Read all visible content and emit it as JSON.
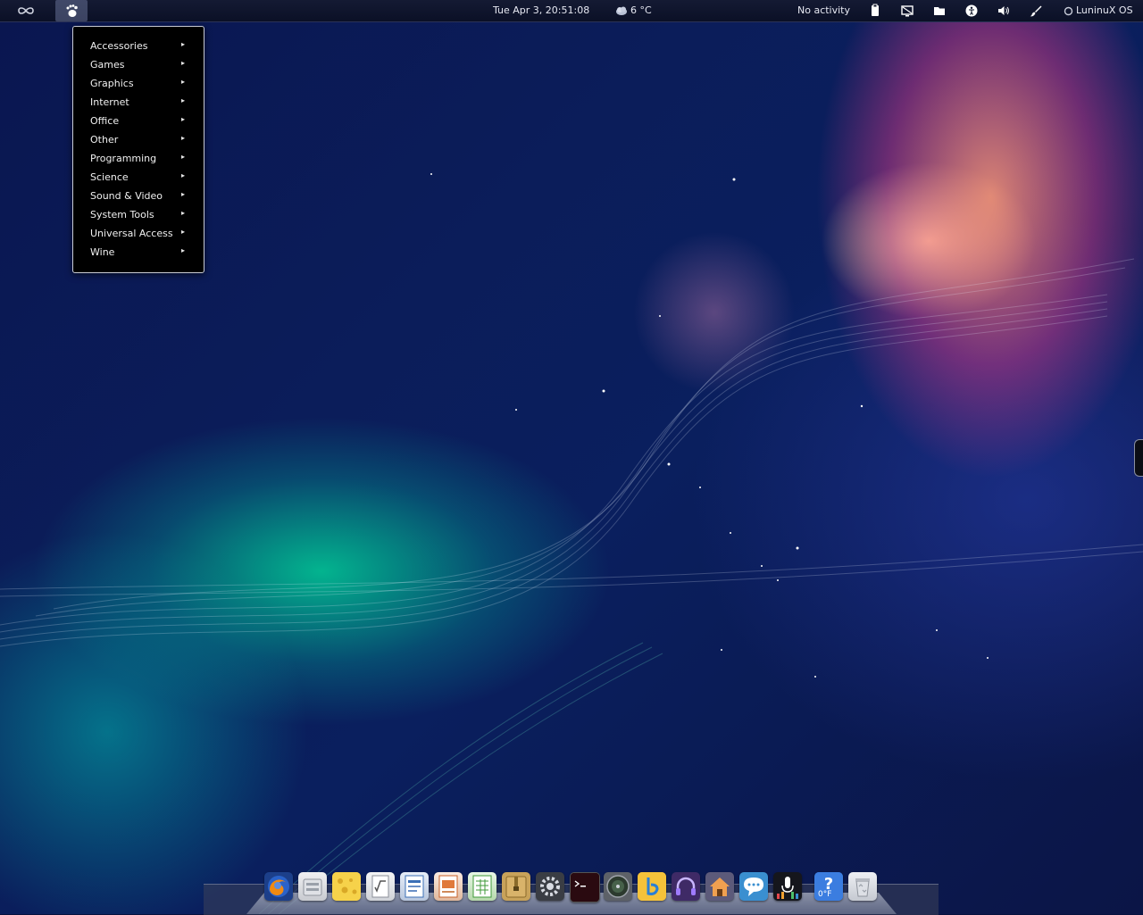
{
  "top_panel": {
    "activities_icon": "infinity-icon",
    "menu_icon": "gnome-foot-icon",
    "clock": "Tue Apr  3, 20:51:08",
    "weather": {
      "icon": "cloud-weather-icon",
      "temperature": "6 °C"
    },
    "activity_status": "No activity",
    "tray_icons": [
      "clipboard-icon",
      "display-icon",
      "folder-icon",
      "accessibility-icon",
      "volume-icon",
      "brush-icon"
    ],
    "user": {
      "icon": "user-status-icon",
      "name": "LuninuX OS"
    }
  },
  "app_menu": {
    "items": [
      {
        "label": "Accessories"
      },
      {
        "label": "Games"
      },
      {
        "label": "Graphics"
      },
      {
        "label": "Internet"
      },
      {
        "label": "Office"
      },
      {
        "label": "Other"
      },
      {
        "label": "Programming"
      },
      {
        "label": "Science"
      },
      {
        "label": "Sound & Video"
      },
      {
        "label": "System Tools"
      },
      {
        "label": "Universal Access"
      },
      {
        "label": "Wine"
      }
    ],
    "submenu_arrow": "▸"
  },
  "dock": {
    "items": [
      {
        "icon": "firefox-icon"
      },
      {
        "icon": "file-manager-icon"
      },
      {
        "icon": "cheese-icon"
      },
      {
        "icon": "libreoffice-math-icon"
      },
      {
        "icon": "libreoffice-writer-icon"
      },
      {
        "icon": "libreoffice-impress-icon"
      },
      {
        "icon": "libreoffice-calc-icon"
      },
      {
        "icon": "archive-manager-icon"
      },
      {
        "icon": "system-settings-icon"
      },
      {
        "icon": "terminal-icon"
      },
      {
        "icon": "disk-utility-icon"
      },
      {
        "icon": "bluetooth-icon"
      },
      {
        "icon": "music-player-icon"
      },
      {
        "icon": "home-app-icon"
      },
      {
        "icon": "chat-icon"
      },
      {
        "icon": "audio-recorder-icon"
      },
      {
        "icon": "weather-help-icon",
        "label": "0°F"
      },
      {
        "icon": "trash-icon"
      }
    ]
  },
  "colors": {
    "panel_bg": "#0b1026",
    "menu_bg": "#000000",
    "menu_border": "#c9ccd6",
    "wallpaper_base": "#0a1650"
  }
}
